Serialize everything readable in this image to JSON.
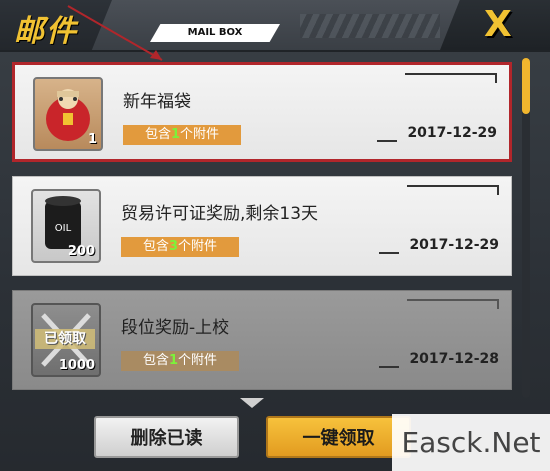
{
  "header": {
    "title": "邮件",
    "subtitle": "MAIL BOX",
    "close_label": "X"
  },
  "mails": [
    {
      "title": "新年福袋",
      "attach_prefix": "包含",
      "attach_count": "1",
      "attach_suffix": "个附件",
      "date": "2017-12-29",
      "icon": "lucky-bag-icon",
      "icon_count": "1",
      "claimed": false,
      "selected": true
    },
    {
      "title": "贸易许可证奖励,剩余13天",
      "attach_prefix": "包含",
      "attach_count": "3",
      "attach_suffix": "个附件",
      "date": "2017-12-29",
      "icon": "oil-barrel-icon",
      "icon_count": "200",
      "icon_text": "OIL",
      "claimed": false,
      "selected": false
    },
    {
      "title": "段位奖励-上校",
      "attach_prefix": "包含",
      "attach_count": "1",
      "attach_suffix": "个附件",
      "date": "2017-12-28",
      "icon": "crossed-swords-icon",
      "icon_count": "1000",
      "claimed_label": "已领取",
      "claimed": true,
      "selected": false
    }
  ],
  "buttons": {
    "delete_read": "删除已读",
    "claim_all": "一键领取"
  },
  "watermark": "Easck.Net",
  "colors": {
    "accent": "#f1c232",
    "selected_border": "#b1262b",
    "attach_badge": "#e29a3d",
    "attach_count": "#7cf23a"
  }
}
